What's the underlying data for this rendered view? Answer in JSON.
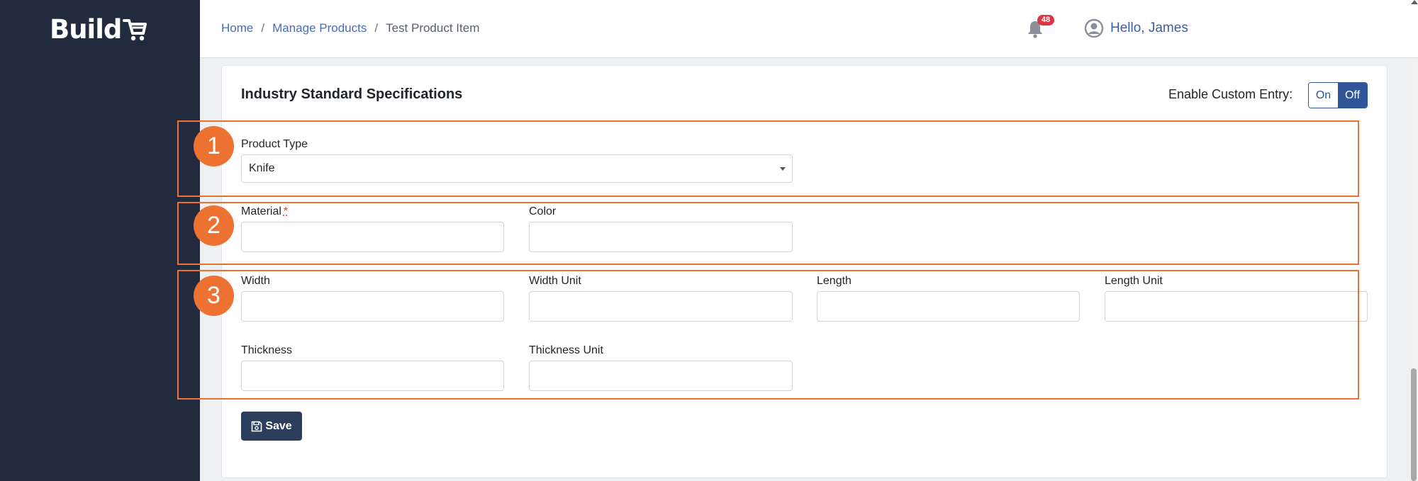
{
  "brand": {
    "logo_text": "Build"
  },
  "breadcrumb": {
    "home": "Home",
    "sep1": "/",
    "manage": "Manage Products",
    "sep2": "/",
    "current": "Test Product Item"
  },
  "header": {
    "notification_count": "48",
    "greeting": "Hello, James"
  },
  "card": {
    "title": "Industry Standard Specifications",
    "custom_entry_label": "Enable Custom Entry:",
    "toggle_on": "On",
    "toggle_off": "Off",
    "toggle_state": "Off"
  },
  "form": {
    "product_type": {
      "label": "Product Type",
      "value": "Knife"
    },
    "material": {
      "label": "Material",
      "required_mark": "*",
      "value": ""
    },
    "color": {
      "label": "Color",
      "value": ""
    },
    "width": {
      "label": "Width",
      "value": ""
    },
    "width_unit": {
      "label": "Width Unit",
      "value": ""
    },
    "length": {
      "label": "Length",
      "value": ""
    },
    "length_unit": {
      "label": "Length Unit",
      "value": ""
    },
    "thickness": {
      "label": "Thickness",
      "value": ""
    },
    "thickness_unit": {
      "label": "Thickness Unit",
      "value": ""
    },
    "save_label": "Save"
  },
  "annotations": {
    "marker1": "1",
    "marker2": "2",
    "marker3": "3",
    "color": "#ed7131"
  },
  "colors": {
    "sidebar": "#222a3d",
    "primary": "#2f5597",
    "save_button": "#2c3e5c",
    "link": "#4a6cb3",
    "badge": "#dc3545"
  },
  "icons": {
    "logo": "cart-icon",
    "notifications": "bell-icon",
    "user": "user-circle-icon",
    "save": "floppy-disk-icon",
    "select": "caret-down-icon"
  }
}
